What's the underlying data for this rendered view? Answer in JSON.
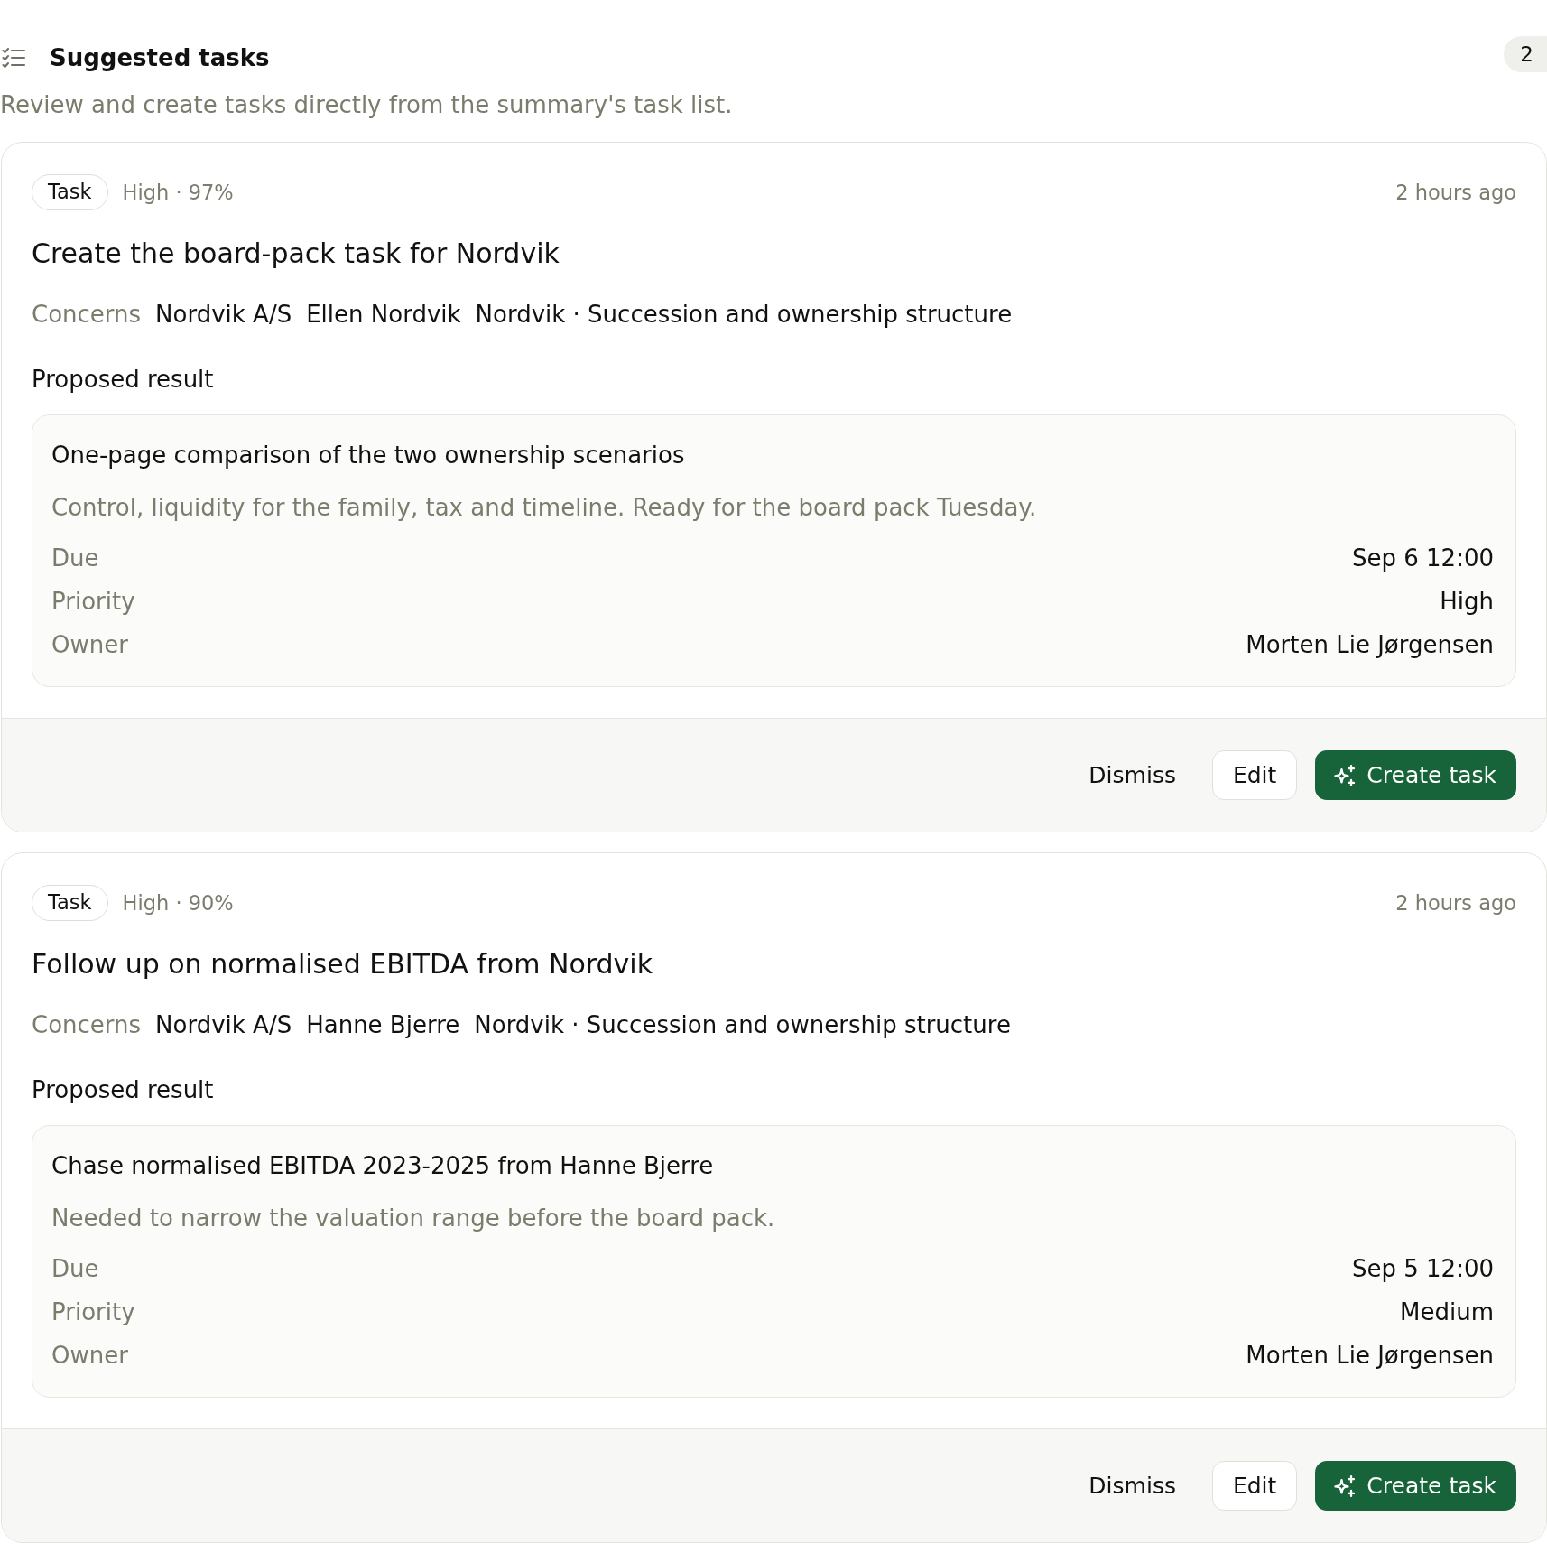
{
  "header": {
    "title": "Suggested tasks",
    "count": "2",
    "subtitle": "Review and create tasks directly from the summary's task list."
  },
  "tasks": [
    {
      "type_tag": "Task",
      "confidence": "High · 97%",
      "age": "2 hours ago",
      "title": "Create the board-pack task for Nordvik",
      "concerns": {
        "label": "Concerns",
        "items": [
          "Nordvik A/S",
          "Ellen Nordvik",
          "Nordvik · Succession and ownership structure"
        ]
      },
      "result": {
        "heading": "Proposed result",
        "title": "One-page comparison of the two ownership scenarios",
        "description": "Control, liquidity for the family, tax and timeline. Ready for the board pack Tuesday.",
        "fields": [
          {
            "label": "Due",
            "value": "Sep 6 12:00"
          },
          {
            "label": "Priority",
            "value": "High"
          },
          {
            "label": "Owner",
            "value": "Morten Lie Jørgensen"
          }
        ]
      },
      "actions": [
        {
          "kind": "plain",
          "label": "Dismiss"
        },
        {
          "kind": "outline",
          "label": "Edit"
        },
        {
          "kind": "primary",
          "label": "Create task"
        }
      ]
    },
    {
      "type_tag": "Task",
      "confidence": "High · 90%",
      "age": "2 hours ago",
      "title": "Follow up on normalised EBITDA from Nordvik",
      "concerns": {
        "label": "Concerns",
        "items": [
          "Nordvik A/S",
          "Hanne Bjerre",
          "Nordvik · Succession and ownership structure"
        ]
      },
      "result": {
        "heading": "Proposed result",
        "title": "Chase normalised EBITDA 2023-2025 from Hanne Bjerre",
        "description": "Needed to narrow the valuation range before the board pack.",
        "fields": [
          {
            "label": "Due",
            "value": "Sep 5 12:00"
          },
          {
            "label": "Priority",
            "value": "Medium"
          },
          {
            "label": "Owner",
            "value": "Morten Lie Jørgensen"
          }
        ]
      },
      "actions": [
        {
          "kind": "plain",
          "label": "Dismiss"
        },
        {
          "kind": "outline",
          "label": "Edit"
        },
        {
          "kind": "primary",
          "label": "Create task"
        }
      ]
    }
  ]
}
